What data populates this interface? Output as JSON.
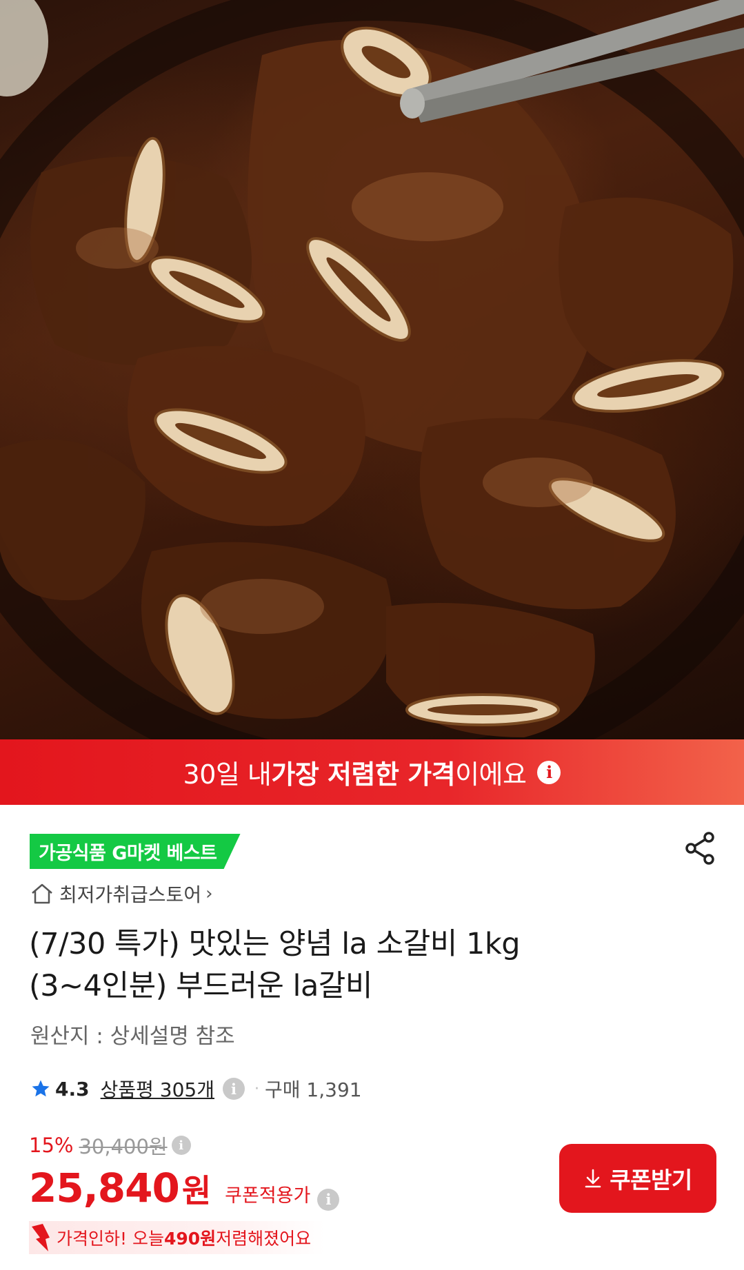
{
  "banner": {
    "prefix": "30일 내 ",
    "bold": "가장 저렴한 가격",
    "suffix": "이에요",
    "info_glyph": "i"
  },
  "badge": {
    "label": "가공식품 G마켓 베스트"
  },
  "share": {
    "icon": "share-icon"
  },
  "store": {
    "icon": "home-icon",
    "name": "최저가취급스토어",
    "chevron": "›"
  },
  "product": {
    "title_line1": "(7/30 특가) 맛있는 양념 la 소갈비 1kg",
    "title_line2": "(3~4인분) 부드러운 la갈비",
    "origin": "원산지 : 상세설명 참조"
  },
  "rating": {
    "icon": "star-icon",
    "score": "4.3",
    "reviews": "상품평 305개",
    "info_glyph": "i",
    "separator": "·",
    "sold": "구매 1,391"
  },
  "pricing": {
    "discount_rate": "15%",
    "original_price": "30,400원",
    "price": "25,840",
    "currency": "원",
    "coupon_label": "쿠폰적용가",
    "info_glyph": "i"
  },
  "coupon_button": {
    "icon": "download-icon",
    "label": "쿠폰받기"
  },
  "price_drop": {
    "icon": "down-arrow-icon",
    "prefix": "가격인하! 오늘 ",
    "amount": "490원",
    "suffix": " 저렴해졌어요"
  },
  "colors": {
    "accent": "#e3161d",
    "badge_green": "#14c944",
    "star_blue": "#1a73e8"
  }
}
